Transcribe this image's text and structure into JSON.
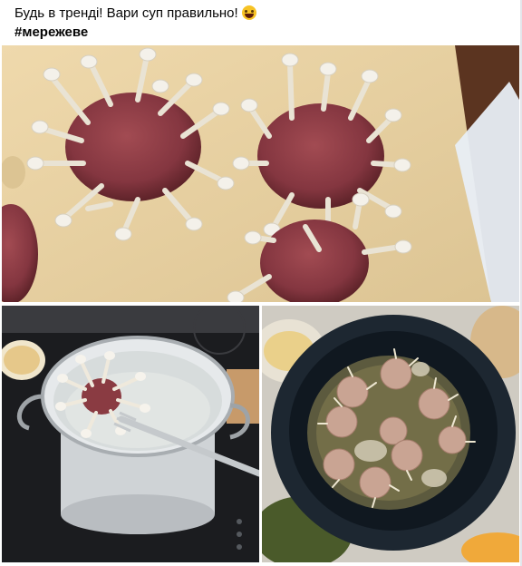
{
  "post": {
    "line1": "Будь в тренді! Вари суп правильно!",
    "emoji_icon": "laughing-face-emoji",
    "hashtag": "#мережеве"
  },
  "photos": {
    "main_icon": "raw-meatballs-with-mushrooms-photo",
    "left_icon": "pot-with-meatball-on-fork-photo",
    "right_icon": "pot-of-meatball-soup-photo"
  },
  "colors": {
    "text": "#050505",
    "meat": "#8a3b42",
    "mushroom": "#f1ede3",
    "paper": "#e6cfa1",
    "stove": "#1c1c1e",
    "pot_rim": "#1d2731"
  }
}
